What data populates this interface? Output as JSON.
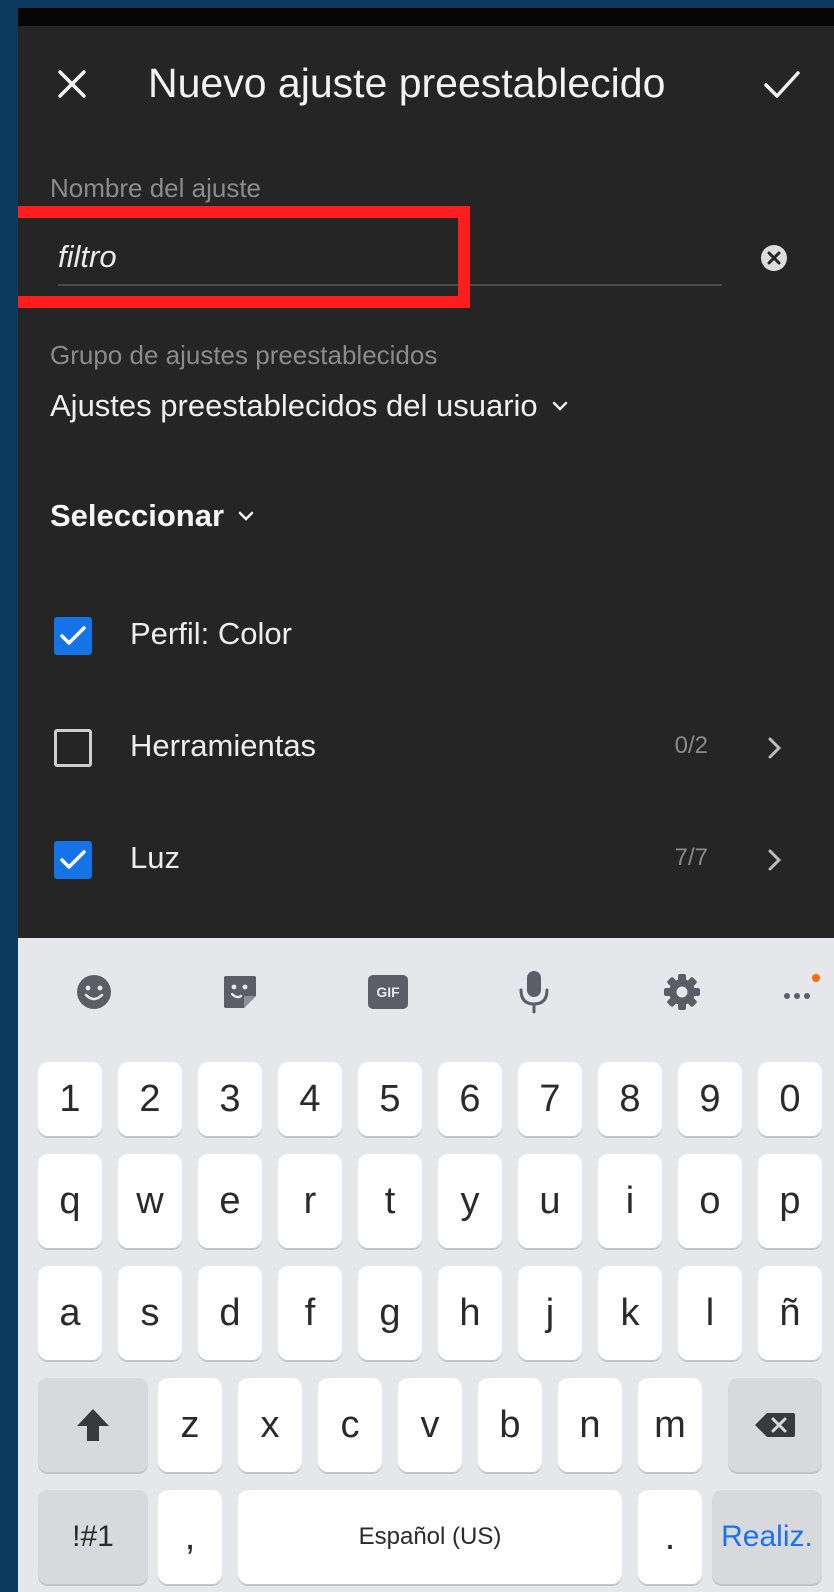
{
  "header": {
    "title": "Nuevo ajuste preestablecido",
    "close_icon": "close-icon",
    "confirm_icon": "check-icon"
  },
  "preset_name": {
    "label": "Nombre del ajuste",
    "value": "filtro"
  },
  "preset_group": {
    "label": "Grupo de ajustes preestablecidos",
    "value": "Ajustes preestablecidos del usuario"
  },
  "select": {
    "label": "Seleccionar"
  },
  "settings": [
    {
      "label": "Perfil: Color",
      "checked": true,
      "count": ""
    },
    {
      "label": "Herramientas",
      "checked": false,
      "count": "0/2"
    },
    {
      "label": "Luz",
      "checked": true,
      "count": "7/7"
    }
  ],
  "keyboard": {
    "toolbar_icons": [
      "emoji-icon",
      "sticker-icon",
      "gif-icon",
      "microphone-icon",
      "settings-icon",
      "more-icon"
    ],
    "gif_label": "GIF",
    "row_numbers": [
      "1",
      "2",
      "3",
      "4",
      "5",
      "6",
      "7",
      "8",
      "9",
      "0"
    ],
    "row_1": [
      "q",
      "w",
      "e",
      "r",
      "t",
      "y",
      "u",
      "i",
      "o",
      "p"
    ],
    "row_2": [
      "a",
      "s",
      "d",
      "f",
      "g",
      "h",
      "j",
      "k",
      "l",
      "ñ"
    ],
    "row_3": [
      "z",
      "x",
      "c",
      "v",
      "b",
      "n",
      "m"
    ],
    "symbols_label": "!#1",
    "comma_label": ",",
    "space_label": "Español (US)",
    "period_label": ".",
    "done_label": "Realiz."
  },
  "colors": {
    "background": "#252525",
    "accent": "#1473e6",
    "highlight": "#ff1e1e",
    "keyboard": "#e6e7ea",
    "notification_dot": "#ff6d00"
  }
}
